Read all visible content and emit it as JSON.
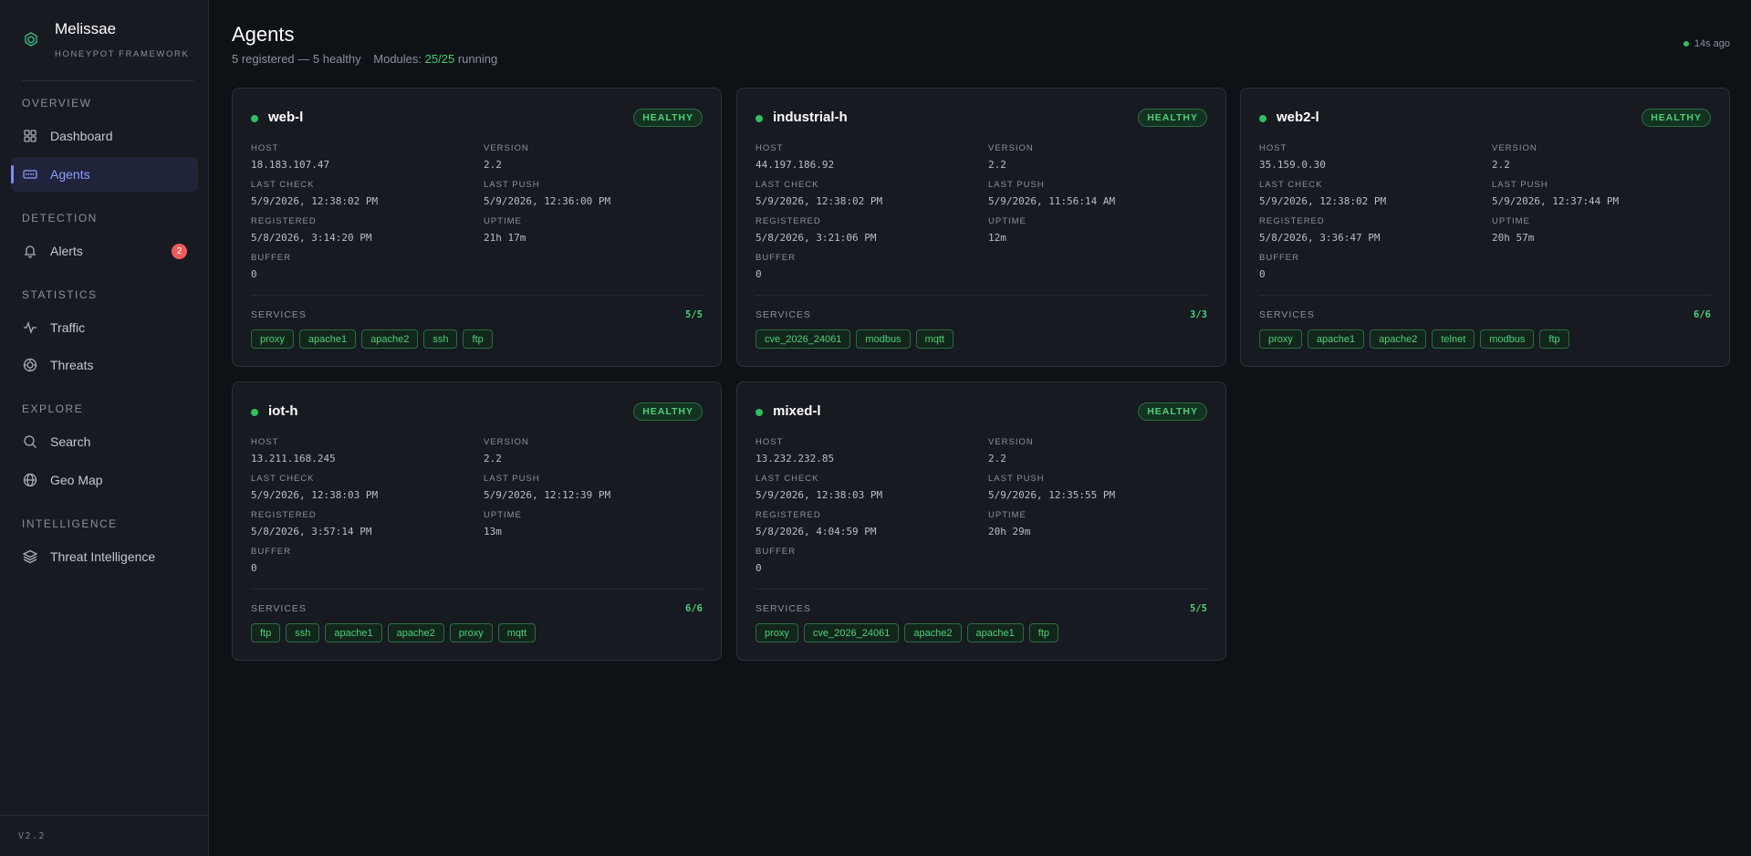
{
  "brand": {
    "name": "Melissae",
    "subtitle": "HONEYPOT FRAMEWORK"
  },
  "sidebar": {
    "sections": [
      {
        "title": "OVERVIEW"
      },
      {
        "title": "DETECTION"
      },
      {
        "title": "STATISTICS"
      },
      {
        "title": "EXPLORE"
      },
      {
        "title": "INTELLIGENCE"
      }
    ],
    "items": [
      {
        "label": "Dashboard",
        "icon": "grid-icon"
      },
      {
        "label": "Agents",
        "icon": "server-icon"
      },
      {
        "label": "Alerts",
        "icon": "bell-icon",
        "badge": "2"
      },
      {
        "label": "Traffic",
        "icon": "activity-icon"
      },
      {
        "label": "Threats",
        "icon": "target-icon"
      },
      {
        "label": "Search",
        "icon": "search-icon"
      },
      {
        "label": "Geo Map",
        "icon": "globe-icon"
      },
      {
        "label": "Threat Intelligence",
        "icon": "layers-icon"
      }
    ],
    "version": "V2.2"
  },
  "header": {
    "title": "Agents",
    "summary": "5 registered — 5 healthy",
    "modules_label": "Modules:",
    "modules_value": "25/25",
    "modules_suffix": "running",
    "updated": "14s ago"
  },
  "labels": {
    "host": "HOST",
    "version": "VERSION",
    "last_check": "LAST CHECK",
    "last_push": "LAST PUSH",
    "registered": "REGISTERED",
    "uptime": "UPTIME",
    "buffer": "BUFFER",
    "services": "SERVICES"
  },
  "colors": {
    "accent": "#7b8cff",
    "healthy": "#4ad17a",
    "alert": "#ef5b5b",
    "background": "#0e1116",
    "panel": "#171a20"
  },
  "agents": [
    {
      "name": "web-l",
      "status": "HEALTHY",
      "host": "18.183.107.47",
      "version": "2.2",
      "last_check": "5/9/2026, 12:38:02 PM",
      "last_push": "5/9/2026, 12:36:00 PM",
      "registered": "5/8/2026, 3:14:20 PM",
      "uptime": "21h 17m",
      "buffer": "0",
      "services_count": "5/5",
      "services": [
        "proxy",
        "apache1",
        "apache2",
        "ssh",
        "ftp"
      ]
    },
    {
      "name": "industrial-h",
      "status": "HEALTHY",
      "host": "44.197.186.92",
      "version": "2.2",
      "last_check": "5/9/2026, 12:38:02 PM",
      "last_push": "5/9/2026, 11:56:14 AM",
      "registered": "5/8/2026, 3:21:06 PM",
      "uptime": "12m",
      "buffer": "0",
      "services_count": "3/3",
      "services": [
        "cve_2026_24061",
        "modbus",
        "mqtt"
      ]
    },
    {
      "name": "web2-l",
      "status": "HEALTHY",
      "host": "35.159.0.30",
      "version": "2.2",
      "last_check": "5/9/2026, 12:38:02 PM",
      "last_push": "5/9/2026, 12:37:44 PM",
      "registered": "5/8/2026, 3:36:47 PM",
      "uptime": "20h 57m",
      "buffer": "0",
      "services_count": "6/6",
      "services": [
        "proxy",
        "apache1",
        "apache2",
        "telnet",
        "modbus",
        "ftp"
      ]
    },
    {
      "name": "iot-h",
      "status": "HEALTHY",
      "host": "13.211.168.245",
      "version": "2.2",
      "last_check": "5/9/2026, 12:38:03 PM",
      "last_push": "5/9/2026, 12:12:39 PM",
      "registered": "5/8/2026, 3:57:14 PM",
      "uptime": "13m",
      "buffer": "0",
      "services_count": "6/6",
      "services": [
        "ftp",
        "ssh",
        "apache1",
        "apache2",
        "proxy",
        "mqtt"
      ]
    },
    {
      "name": "mixed-l",
      "status": "HEALTHY",
      "host": "13.232.232.85",
      "version": "2.2",
      "last_check": "5/9/2026, 12:38:03 PM",
      "last_push": "5/9/2026, 12:35:55 PM",
      "registered": "5/8/2026, 4:04:59 PM",
      "uptime": "20h 29m",
      "buffer": "0",
      "services_count": "5/5",
      "services": [
        "proxy",
        "cve_2026_24061",
        "apache2",
        "apache1",
        "ftp"
      ]
    }
  ]
}
